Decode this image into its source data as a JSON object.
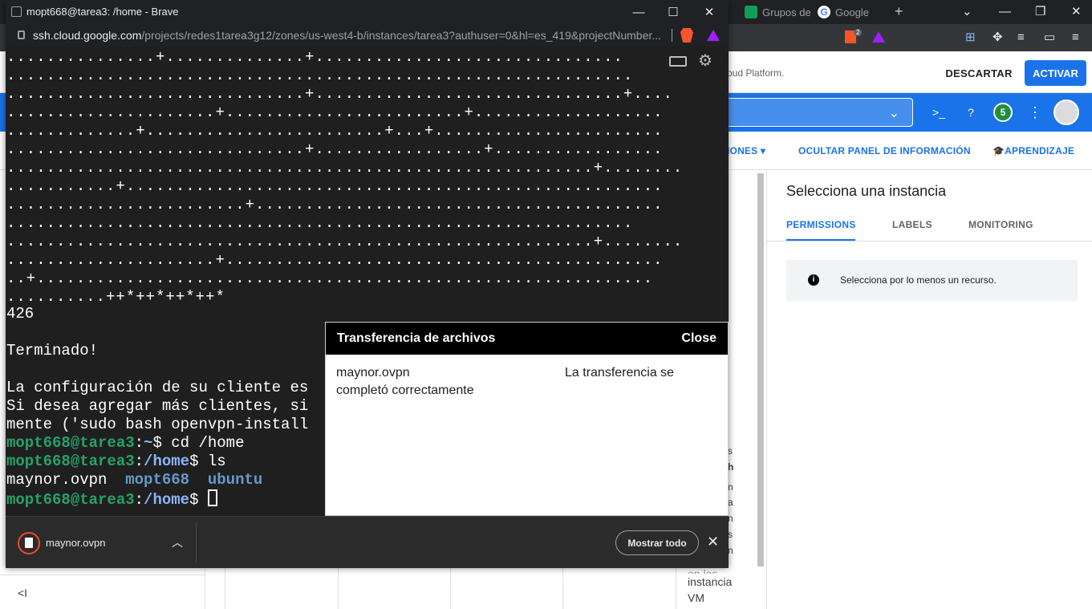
{
  "background_browser": {
    "tabs": [
      {
        "label": "Grupos de",
        "icon": "sheets-icon"
      },
      {
        "label": "Google",
        "icon": "google-g-icon"
      }
    ],
    "new_tab_symbol": "+",
    "brave_badge_count": "2"
  },
  "cloud_console": {
    "promo_text": "oud Platform.",
    "discard_label": "DESCARTAR",
    "activate_label": "ACTIVAR",
    "notifications_count": "5",
    "actions": {
      "ops_label": "IONES",
      "hide_info_panel_label": "OCULTAR PANEL DE INFORMACIÓN",
      "learning_label": "APRENDIZAJE"
    },
    "info_panel": {
      "title": "Selecciona una instancia",
      "tabs": [
        "PERMISSIONS",
        "LABELS",
        "MONITORING"
      ],
      "message": "Selecciona por lo menos un recurso."
    },
    "peek_letters": [
      "s",
      "h",
      "n",
      "a",
      "n",
      "s",
      "n"
    ],
    "column_text": [
      "en las",
      "instancia",
      "VM"
    ],
    "collapse_icon": "collapse-left-icon"
  },
  "ssh_window": {
    "title": "mopt668@tarea3: /home - Brave",
    "url_host": "ssh.cloud.google.com",
    "url_path": "/projects/redes1tarea3g12/zones/us-west4-b/instances/tarea3?authuser=0&hl=es_419&projectNumber...",
    "window_buttons": {
      "minimize": "—",
      "maximize": "☐",
      "close": "✕"
    }
  },
  "terminal": {
    "art_lines": [
      "...............+..............+...............................",
      "...............................................................",
      "..............................+...............................+....",
      ".....................+........................+...................",
      ".............+........................+...+.......................",
      "..............................+.................+.................",
      "...........................................................+........",
      "...........+......................................................",
      "........................+.........................................",
      "...............................................................",
      "...........................................................+........",
      ".....................+............................................",
      "..+..............................................................",
      "..........++*++*++*++*"
    ],
    "count": "426",
    "finished": "Terminado!",
    "config_line": "La configuración de su cliente es",
    "add_clients_line": "Si desea agregar más clientes, si",
    "mente_line": "mente ('sudo bash openvpn-install",
    "prompt1": {
      "user": "mopt668@tarea3",
      "path": "~",
      "cmd": " cd /home"
    },
    "prompt2": {
      "user": "mopt668@tarea3",
      "path": "/home",
      "cmd": " ls"
    },
    "ls_output": {
      "file": "maynor.ovpn",
      "dir1": "mopt668",
      "dir2": "ubuntu"
    },
    "prompt3": {
      "user": "mopt668@tarea3",
      "path": "/home"
    }
  },
  "transfer_dialog": {
    "title": "Transferencia de archivos",
    "close_label": "Close",
    "file_name": "maynor.ovpn",
    "status": "La transferencia se completó correctamente"
  },
  "download_bar": {
    "file_name": "maynor.ovpn",
    "show_all_label": "Mostrar todo",
    "close_symbol": "✕"
  },
  "colors": {
    "accent": "#1a73e8",
    "prompt_user": "#26a269",
    "prompt_path": "#8ab4f8",
    "terminal_bg": "#1f1f1f"
  }
}
